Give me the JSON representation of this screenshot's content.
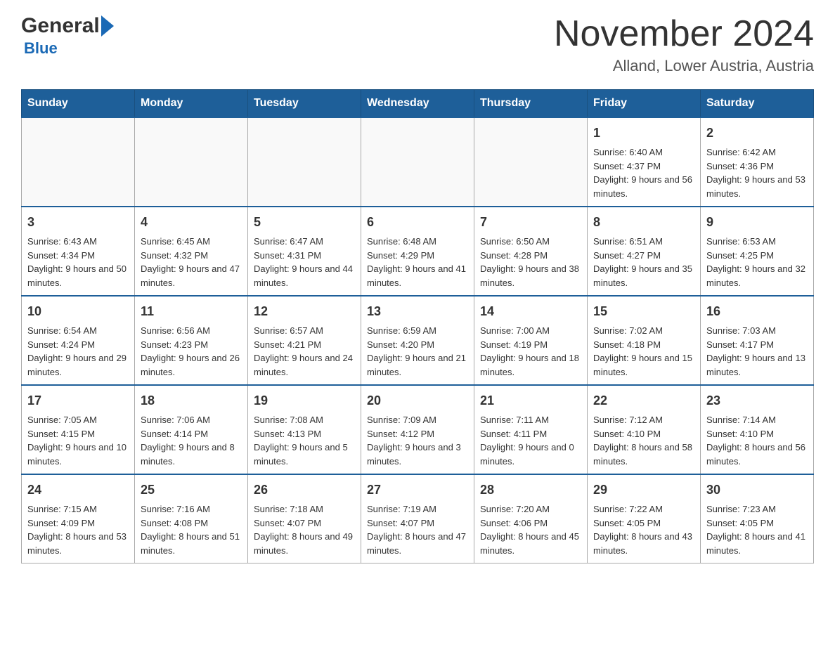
{
  "header": {
    "logo_general": "General",
    "logo_blue": "Blue",
    "month_title": "November 2024",
    "location": "Alland, Lower Austria, Austria"
  },
  "weekdays": [
    "Sunday",
    "Monday",
    "Tuesday",
    "Wednesday",
    "Thursday",
    "Friday",
    "Saturday"
  ],
  "weeks": [
    [
      {
        "day": "",
        "info": ""
      },
      {
        "day": "",
        "info": ""
      },
      {
        "day": "",
        "info": ""
      },
      {
        "day": "",
        "info": ""
      },
      {
        "day": "",
        "info": ""
      },
      {
        "day": "1",
        "info": "Sunrise: 6:40 AM\nSunset: 4:37 PM\nDaylight: 9 hours and 56 minutes."
      },
      {
        "day": "2",
        "info": "Sunrise: 6:42 AM\nSunset: 4:36 PM\nDaylight: 9 hours and 53 minutes."
      }
    ],
    [
      {
        "day": "3",
        "info": "Sunrise: 6:43 AM\nSunset: 4:34 PM\nDaylight: 9 hours and 50 minutes."
      },
      {
        "day": "4",
        "info": "Sunrise: 6:45 AM\nSunset: 4:32 PM\nDaylight: 9 hours and 47 minutes."
      },
      {
        "day": "5",
        "info": "Sunrise: 6:47 AM\nSunset: 4:31 PM\nDaylight: 9 hours and 44 minutes."
      },
      {
        "day": "6",
        "info": "Sunrise: 6:48 AM\nSunset: 4:29 PM\nDaylight: 9 hours and 41 minutes."
      },
      {
        "day": "7",
        "info": "Sunrise: 6:50 AM\nSunset: 4:28 PM\nDaylight: 9 hours and 38 minutes."
      },
      {
        "day": "8",
        "info": "Sunrise: 6:51 AM\nSunset: 4:27 PM\nDaylight: 9 hours and 35 minutes."
      },
      {
        "day": "9",
        "info": "Sunrise: 6:53 AM\nSunset: 4:25 PM\nDaylight: 9 hours and 32 minutes."
      }
    ],
    [
      {
        "day": "10",
        "info": "Sunrise: 6:54 AM\nSunset: 4:24 PM\nDaylight: 9 hours and 29 minutes."
      },
      {
        "day": "11",
        "info": "Sunrise: 6:56 AM\nSunset: 4:23 PM\nDaylight: 9 hours and 26 minutes."
      },
      {
        "day": "12",
        "info": "Sunrise: 6:57 AM\nSunset: 4:21 PM\nDaylight: 9 hours and 24 minutes."
      },
      {
        "day": "13",
        "info": "Sunrise: 6:59 AM\nSunset: 4:20 PM\nDaylight: 9 hours and 21 minutes."
      },
      {
        "day": "14",
        "info": "Sunrise: 7:00 AM\nSunset: 4:19 PM\nDaylight: 9 hours and 18 minutes."
      },
      {
        "day": "15",
        "info": "Sunrise: 7:02 AM\nSunset: 4:18 PM\nDaylight: 9 hours and 15 minutes."
      },
      {
        "day": "16",
        "info": "Sunrise: 7:03 AM\nSunset: 4:17 PM\nDaylight: 9 hours and 13 minutes."
      }
    ],
    [
      {
        "day": "17",
        "info": "Sunrise: 7:05 AM\nSunset: 4:15 PM\nDaylight: 9 hours and 10 minutes."
      },
      {
        "day": "18",
        "info": "Sunrise: 7:06 AM\nSunset: 4:14 PM\nDaylight: 9 hours and 8 minutes."
      },
      {
        "day": "19",
        "info": "Sunrise: 7:08 AM\nSunset: 4:13 PM\nDaylight: 9 hours and 5 minutes."
      },
      {
        "day": "20",
        "info": "Sunrise: 7:09 AM\nSunset: 4:12 PM\nDaylight: 9 hours and 3 minutes."
      },
      {
        "day": "21",
        "info": "Sunrise: 7:11 AM\nSunset: 4:11 PM\nDaylight: 9 hours and 0 minutes."
      },
      {
        "day": "22",
        "info": "Sunrise: 7:12 AM\nSunset: 4:10 PM\nDaylight: 8 hours and 58 minutes."
      },
      {
        "day": "23",
        "info": "Sunrise: 7:14 AM\nSunset: 4:10 PM\nDaylight: 8 hours and 56 minutes."
      }
    ],
    [
      {
        "day": "24",
        "info": "Sunrise: 7:15 AM\nSunset: 4:09 PM\nDaylight: 8 hours and 53 minutes."
      },
      {
        "day": "25",
        "info": "Sunrise: 7:16 AM\nSunset: 4:08 PM\nDaylight: 8 hours and 51 minutes."
      },
      {
        "day": "26",
        "info": "Sunrise: 7:18 AM\nSunset: 4:07 PM\nDaylight: 8 hours and 49 minutes."
      },
      {
        "day": "27",
        "info": "Sunrise: 7:19 AM\nSunset: 4:07 PM\nDaylight: 8 hours and 47 minutes."
      },
      {
        "day": "28",
        "info": "Sunrise: 7:20 AM\nSunset: 4:06 PM\nDaylight: 8 hours and 45 minutes."
      },
      {
        "day": "29",
        "info": "Sunrise: 7:22 AM\nSunset: 4:05 PM\nDaylight: 8 hours and 43 minutes."
      },
      {
        "day": "30",
        "info": "Sunrise: 7:23 AM\nSunset: 4:05 PM\nDaylight: 8 hours and 41 minutes."
      }
    ]
  ]
}
